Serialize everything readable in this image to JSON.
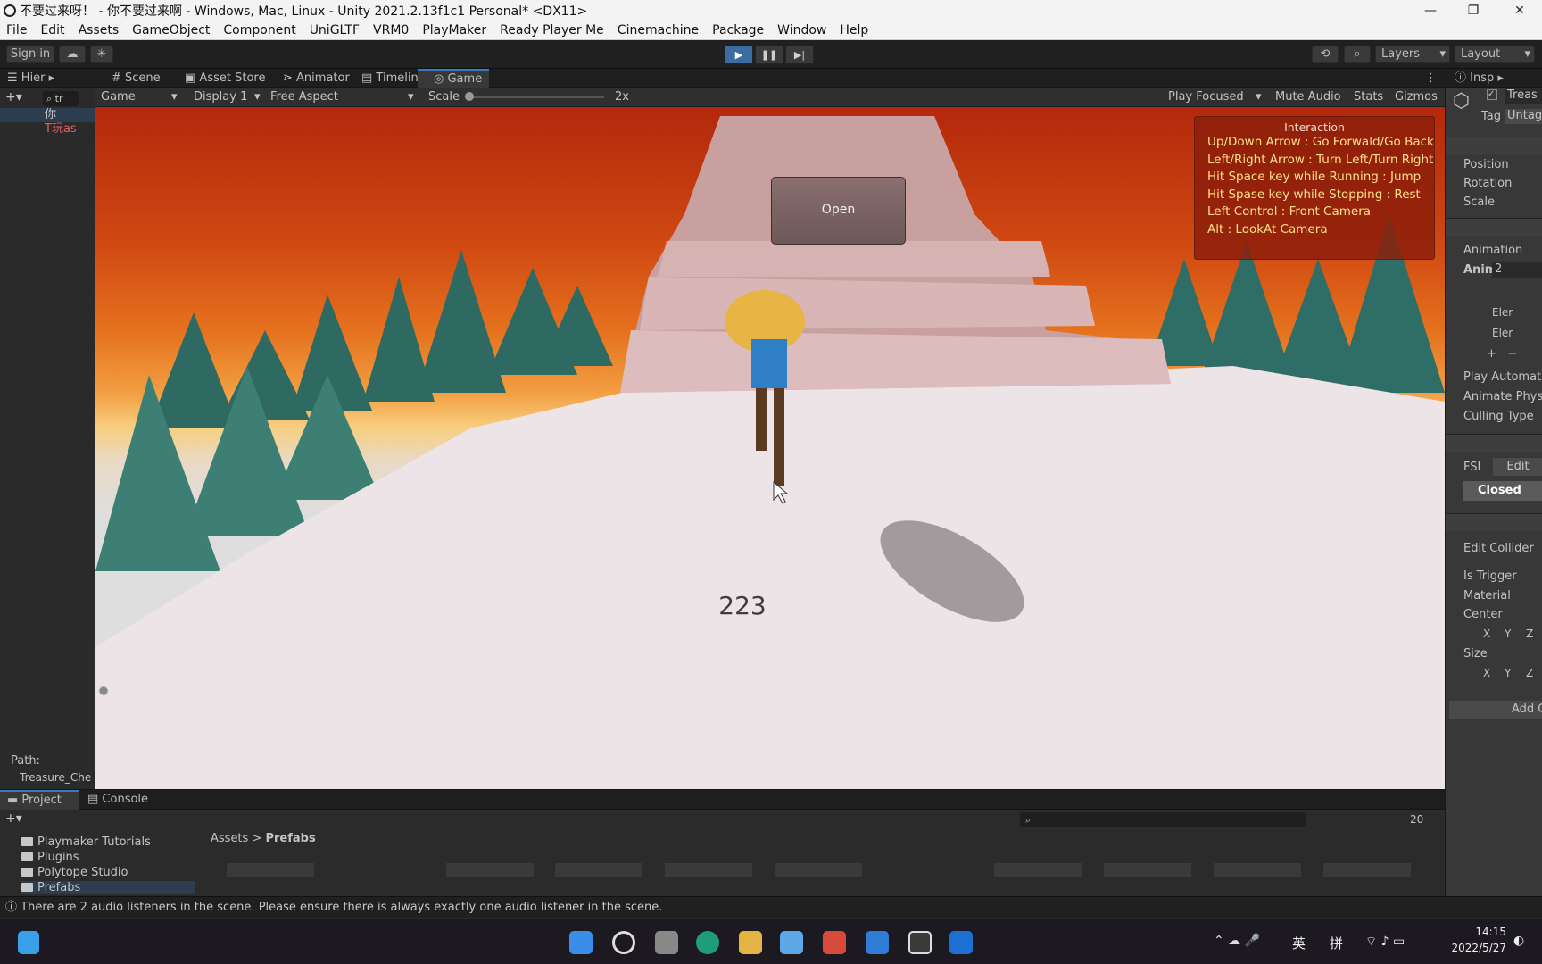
{
  "window": {
    "title": "不要过来呀！ - 你不要过来啊 - Windows, Mac, Linux - Unity 2021.2.13f1c1 Personal* <DX11>",
    "minimize": "—",
    "maximize": "❐",
    "close": "✕"
  },
  "menu": [
    "File",
    "Edit",
    "Assets",
    "GameObject",
    "Component",
    "UniGLTF",
    "VRM0",
    "PlayMaker",
    "Ready Player Me",
    "Cinemachine",
    "Package",
    "Window",
    "Help"
  ],
  "toolbar": {
    "sign_in": "Sign in",
    "layers": "Layers",
    "layout": "Layout",
    "play_icon": "play-icon",
    "pause_icon": "pause-icon",
    "step_icon": "step-icon"
  },
  "hierarchy": {
    "tab": "Hier",
    "search": "tr",
    "items": [
      "你",
      "T玩as"
    ],
    "path_label": "Path:",
    "path_value": "Treasure_Che"
  },
  "view_tabs": [
    "Scene",
    "Asset Store",
    "Animator",
    "Timeline",
    "Game"
  ],
  "game_bar": {
    "mode": "Game",
    "display": "Display 1",
    "aspect": "Free Aspect",
    "scale_label": "Scale",
    "scale_value": "2x",
    "play_focused": "Play Focused",
    "mute": "Mute Audio",
    "stats": "Stats",
    "gizmos": "Gizmos"
  },
  "game": {
    "interaction_title": "Interaction",
    "interaction_lines": [
      "Up/Down Arrow : Go Forwald/Go Back",
      "Left/Right Arrow : Turn Left/Turn Right",
      "Hit Space key while Running : Jump",
      "Hit Spase key while Stopping : Rest",
      "Left Control : Front Camera",
      "Alt : LookAt Camera"
    ],
    "open_button": "Open",
    "counter": "223"
  },
  "inspector": {
    "tab": "Insp",
    "object_name": "Treas",
    "tag_label": "Tag",
    "tag_value": "Untag",
    "transform": [
      "Position",
      "Rotation",
      "Scale"
    ],
    "animation_label": "Animation",
    "anim_label": "Anim",
    "anim_count": "2",
    "elements": [
      "Eler",
      "Eler"
    ],
    "anim_props": [
      "Play Automatic",
      "Animate Physic",
      "Culling Type"
    ],
    "fsm_label": "FSI",
    "fsm_edit": "Edit",
    "fsm_state": "Closed",
    "collider": [
      "Edit Collider",
      "Is Trigger",
      "Material",
      "Center",
      "Size"
    ],
    "xyz": [
      "X",
      "Y",
      "Z"
    ],
    "add_component": "Add C"
  },
  "project": {
    "tabs": [
      "Project",
      "Console"
    ],
    "folders": [
      "Playmaker Tutorials",
      "Plugins",
      "Polytope Studio",
      "Prefabs"
    ],
    "breadcrumb_root": "Assets",
    "breadcrumb_current": "Prefabs",
    "hidden_count": "20"
  },
  "status": {
    "message": "There are 2 audio listeners in the scene. Please ensure there is always exactly one audio listener in the scene."
  },
  "taskbar": {
    "ime1": "英",
    "ime2": "拼",
    "time": "14:15",
    "date": "2022/5/27"
  }
}
